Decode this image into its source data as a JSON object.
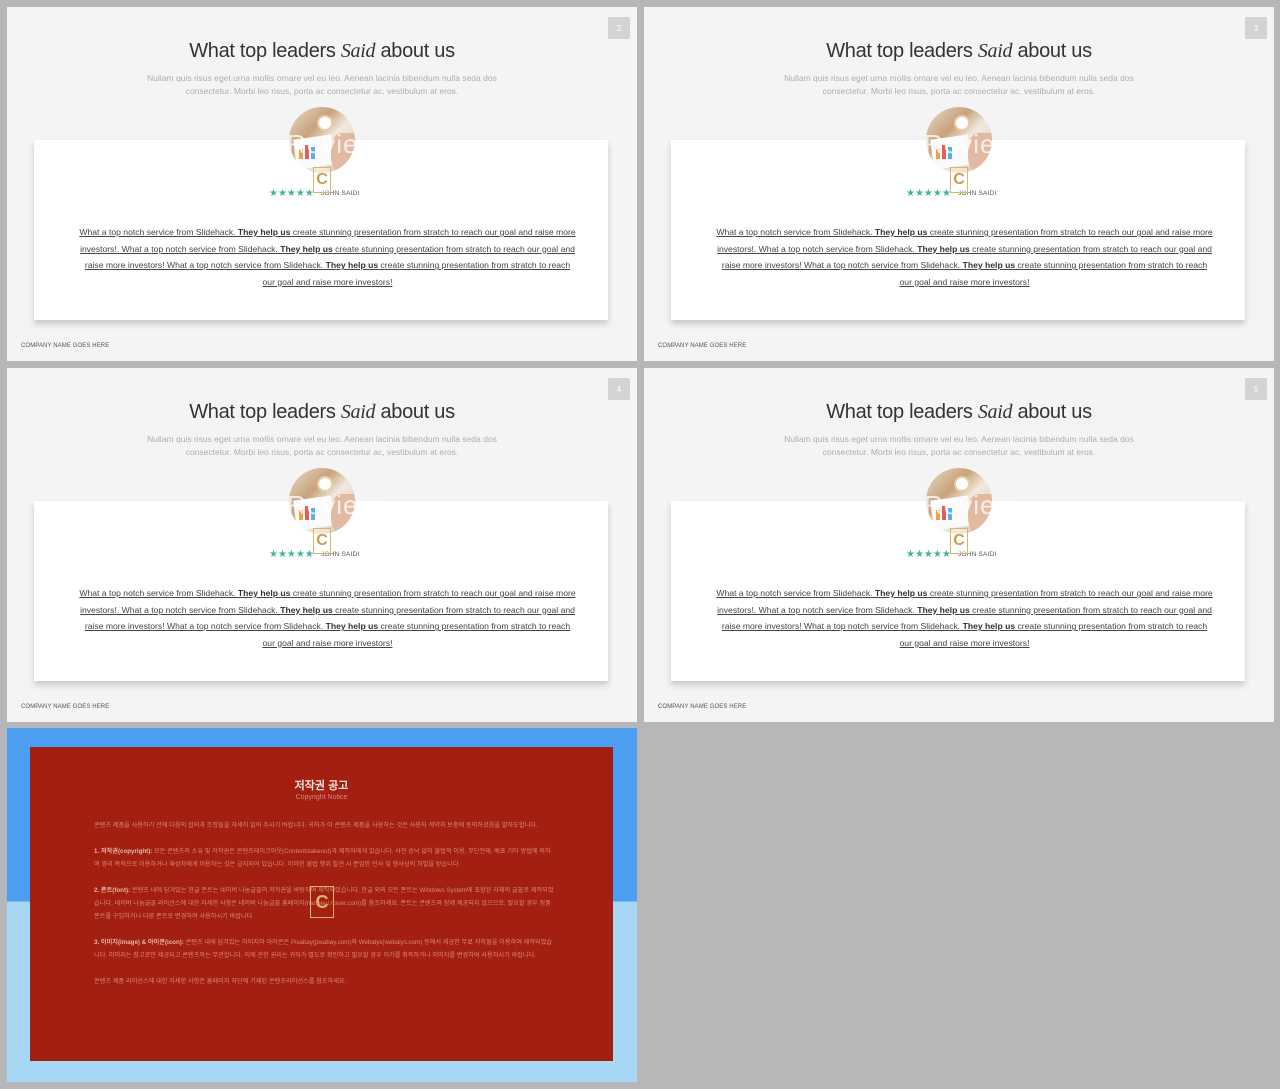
{
  "slides": [
    {
      "page_number": "2",
      "title_before": "What top leaders ",
      "title_emphasis": "Said",
      "title_after": " about us",
      "subtitle": "Nullam quis risus eget urna mollis ornare vel eu leo. Aenean lacinia bibendum nulla seda dos consectetur. Morbi leo risus, porta ac consectetur ac, vestibulum at eros.",
      "watermark": "Review",
      "badge": "C",
      "stars": "★★★★★",
      "reviewer": "JOHN SAIDI",
      "quote_parts": [
        "What a top notch service from  Slidehack. ",
        "They help us",
        " create stunning presentation from stratch to reach our goal and raise more investors!. What a top notch service from  Slidehack. ",
        "They help us",
        " create stunning presentation from stratch to reach our goal and raise more investors! What a top notch service from  Slidehack. ",
        "They help us",
        " create stunning presentation from stratch to reach our goal and raise more investors!"
      ],
      "footer": "COMPANY NAME GOES HERE"
    },
    {
      "page_number": "3",
      "title_before": "What top leaders ",
      "title_emphasis": "Said",
      "title_after": " about us",
      "subtitle": "Nullam quis risus eget urna mollis ornare vel eu leo. Aenean lacinia bibendum nulla seda dos consectetur. Morbi leo risus, porta ac consectetur ac, vestibulum at eros.",
      "watermark": "Review",
      "badge": "C",
      "stars": "★★★★★",
      "reviewer": "JOHN SAIDI",
      "quote_parts": [
        "What a top notch service from  Slidehack. ",
        "They help us",
        " create stunning presentation from stratch to reach our goal and raise more investors!. What a top notch service from  Slidehack. ",
        "They help us",
        " create stunning presentation from stratch to reach our goal and raise more investors! What a top notch service from  Slidehack. ",
        "They help us",
        " create stunning presentation from stratch to reach our goal and raise more investors!"
      ],
      "footer": "COMPANY NAME GOES HERE"
    },
    {
      "page_number": "4",
      "title_before": "What top leaders ",
      "title_emphasis": "Said",
      "title_after": " about us",
      "subtitle": "Nullam quis risus eget urna mollis ornare vel eu leo. Aenean lacinia bibendum nulla seda dos consectetur. Morbi leo risus, porta ac consectetur ac, vestibulum at eros.",
      "watermark": "Review",
      "badge": "C",
      "stars": "★★★★★",
      "reviewer": "JOHN SAIDI",
      "quote_parts": [
        "What a top notch service from  Slidehack. ",
        "They help us",
        " create stunning presentation from stratch to reach our goal and raise more investors!. What a top notch service from  Slidehack. ",
        "They help us",
        " create stunning presentation from stratch to reach our goal and raise more investors! What a top notch service from  Slidehack. ",
        "They help us",
        " create stunning presentation from stratch to reach our goal and raise more investors!"
      ],
      "footer": "COMPANY NAME GOES HERE"
    },
    {
      "page_number": "5",
      "title_before": "What top leaders ",
      "title_emphasis": "Said",
      "title_after": " about us",
      "subtitle": "Nullam quis risus eget urna mollis ornare vel eu leo. Aenean lacinia bibendum nulla seda dos consectetur. Morbi leo risus, porta ac consectetur ac, vestibulum at eros.",
      "watermark": "Review",
      "badge": "C",
      "stars": "★★★★★",
      "reviewer": "JOHN SAIDI",
      "quote_parts": [
        "What a top notch service from  Slidehack. ",
        "They help us",
        " create stunning presentation from stratch to reach our goal and raise more investors!. What a top notch service from  Slidehack. ",
        "They help us",
        " create stunning presentation from stratch to reach our goal and raise more investors! What a top notch service from  Slidehack. ",
        "They help us",
        " create stunning presentation from stratch to reach our goal and raise more investors!"
      ],
      "footer": "COMPANY NAME GOES HERE"
    }
  ],
  "copyright": {
    "title": "저작권 공고",
    "subtitle": "Copyright Notice",
    "badge": "C",
    "intro": "콘텐츠 제품을 사용하기 전에 다음의 합의과 조항들을 자세히 읽어 주시기 바랍니다. 귀하가 이 콘텐츠 제품을 사용하는 것은 사용자 계약과 보충에 동의하셨음을 말하도합니다.",
    "s1_head": "1. 저작권(copyright):",
    "s1_text": " 모든 콘텐츠의 소유 및 저작권은 콘텐츠테이크아웃(Contentstakeout)과 제작자에게 있습니다. 사전 승낙 없이 불법적 이용, 무단전재, 배포 기타 방법에 의하여 영리 목적으로 이용하거나 재성자에게 이용하는 것은 금지되어 있습니다. 이러한 불법 행위 발견 시 준엄한 민사 및 형사상의 처벌을 받습니다.",
    "s2_head": "2. 폰트(font):",
    "s2_text": " 콘텐츠 내에 담겨있는 한글 폰트는 네이버 나눔글꼴의 저작권을 바탕하여 제작되었습니다. 한글 외의 모든 폰트는 Windows System에 포함된 자체의 글꼴로 제작되었습니다. 네이버 나눔글꼴 라이선스에 대한 자세한 사항은 네이버 나눔글꼴 홈페이지(hangeul.naver.com)를 참조하세요. 폰트는 콘텐츠와 함께 제공되지 않으므로, 필요할 경우 정품 폰트를 구입하거나 다른 폰트로 변경하여 사용하시기 바랍니다.",
    "s3_head": "3. 이미지(image) & 아이콘(icon):",
    "s3_text": " 콘텐츠 내에 담겨있는 이미지와 아이콘은 Pixabay(pixabay.com)와 Webalys(webalys.com) 등에서 제공한 무료 저작물을 이용하여 제작되었습니다. 이미지는 참고로만 제공되고 콘텐츠와는 무관합니다. 이에 관한 권리는 귀하가 별도로 확인하고 필요할 경우 허가를 취득하거나 이미지를 변경하여 사용하시기 바랍니다.",
    "outro": "콘텐츠 제품 라이선스에 대한 자세한 사항은 홈페이지 하단에 기재된 콘텐츠라이선스를 참조하세요."
  }
}
